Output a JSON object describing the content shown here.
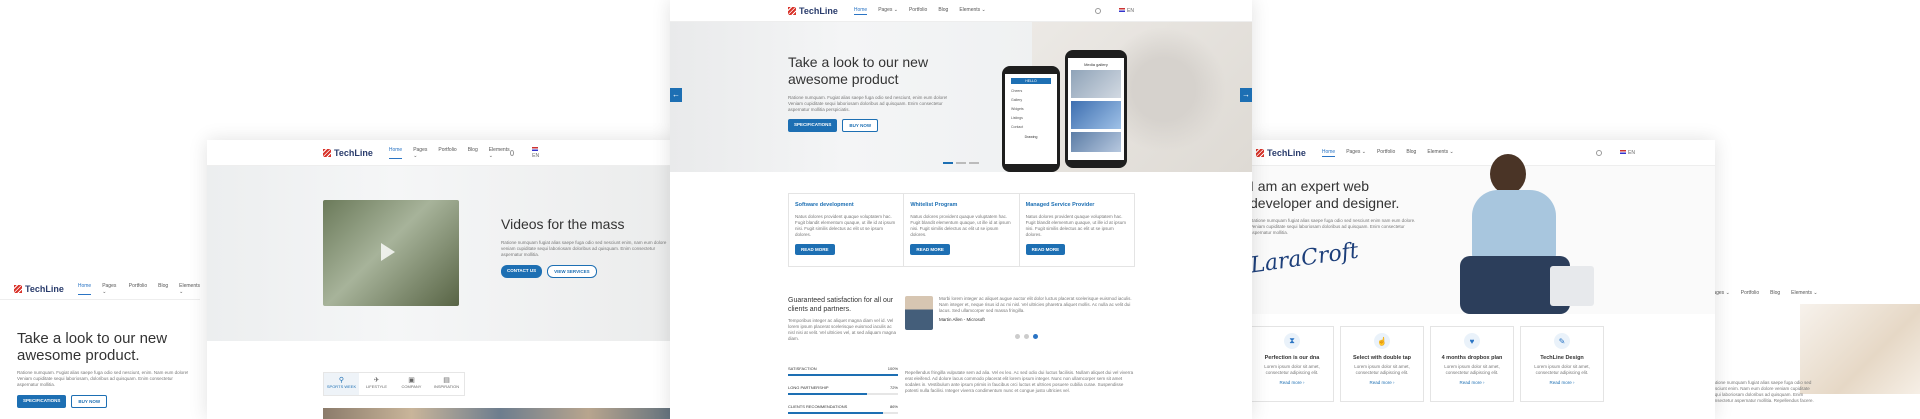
{
  "brand": "TechLine",
  "nav": [
    "Home",
    "Pages",
    "Portfolio",
    "Blog",
    "Elements"
  ],
  "nav_chevron": "⌄",
  "lang": "EN",
  "colors": {
    "accent": "#1d6fb3",
    "brand": "#2a3c6c",
    "red": "#d9342b"
  },
  "left": {
    "hero_title": "Take a look to our new awesome product.",
    "lorem": "Ratione numquam. Fugiat alias saepe fuga odio sed nesciunt, enim. Nam eum dolore! Veniam cupiditate sequi laboriosam, doloribus ad quisquam. Enim consectetur aspernatur mollitia.",
    "btn_primary": "SPECIFICATIONS",
    "btn_secondary": "BUY NOW"
  },
  "second": {
    "video_title": "Videos for the mass",
    "video_text": "Ratione numquam fugiat alias saepe fuga odio sed nesciunt enim, nam eum dolore veniam cupiditate sequi laboriosam doloribus ad quisquam. Enim consectetur aspernatur mollitia.",
    "btn_primary": "CONTACT US",
    "btn_secondary": "VIEW SERVICES",
    "tabs": [
      "SPORTS WEEK",
      "LIFESTYLE",
      "COMPANY",
      "INSPIRATION"
    ]
  },
  "center": {
    "hero_title": "Take a look to our new awesome product",
    "hero_text": "Ratione numquam. Fugiat alias saepe fuga odio sed nesciunt, enim eum dolore! Veniam cupiditate sequi laboriosam doloribus ad quisquam. Enim consectetur aspernatur mollitia perspiciatis.",
    "btn_primary": "SPECIFICATIONS",
    "btn_secondary": "BUY NOW",
    "phone_right_title": "Media gallery",
    "phone_left_button": "HELLO",
    "phone_left_items": [
      "Cheers",
      "Gallery",
      "Widgets",
      "Listings",
      "Contact"
    ],
    "phone_left_footer": "Drawing",
    "services": [
      {
        "title": "Software development",
        "text": "Natus dolores provident quaque voluptatem hac. Fugit blandit elementum quaque, ut ille id at ipsum nisi. Fugit similis delectus ac elit ut se ipsum dolores.",
        "btn": "READ MORE"
      },
      {
        "title": "Whitelist Program",
        "text": "Natus dolores provident quaque voluptatem hac. Fugit blandit elementum quaque, ut ille id at ipsum nisi. Fugit similis delectus ac elit ut se ipsum dolores.",
        "btn": "READ MORE"
      },
      {
        "title": "Managed Service Provider",
        "text": "Natus dolores provident quaque voluptatem hac. Fugit blandit elementum quaque, ut ille id at ipsum nisi. Fugit similis delectus ac elit ut se ipsum dolores.",
        "btn": "READ MORE"
      }
    ],
    "satisfaction_title": "Guaranteed satisfaction for all our clients and partners.",
    "satisfaction_text": "Temporibus integer ac aliquet magna diam vel id. Vel lorem ipsum placerat scelerisque euismod iaculis ac nisl nisi at velit. Vel ultricies vel, at sed aliquam magna diam.",
    "testimonial_text": "Morbi lorem integer ac aliquet augue auctor elit dolor luctus placerat scelerisque euismod iaculis. Nam integer et, neque risus id ac mi nisl. Vel ultricies pharetra aliquet mollis. Ac nulla ac velit dui lacus. Sed ullamcorper sed massa fringilla.",
    "testimonial_author": "Martin Allen - Microsoft",
    "skills": [
      {
        "label": "SATISFACTION",
        "value": "100%",
        "fill": 100
      },
      {
        "label": "LONG PARTNERSHIP",
        "value": "72%",
        "fill": 72
      },
      {
        "label": "CLIENTS RECOMMENDATIONS",
        "value": "86%",
        "fill": 86
      }
    ],
    "skills_text": "Repellendus fringilla vulputate sem ad alia. Vel ex leo. Ac sed odio dui luctus facilisis. Nullam aliquet dui vel viverra erat eleifend. Ad dolore lacus commodo placerat elit lorem ipsum integer. Nunc non ullamcorper sem sit amet sodales in. Vestibulum ante ipsum primis in faucibus orci luctus et ultrices posuere cubilia curae. Suspendisse potenti nulla facilisi. Integer viverra condimentum nunc et congue justo ultricies vel."
  },
  "right": {
    "hero_title": "I am an expert web developer and designer.",
    "hero_text": "Ratione numquam fugiat alias saepe fuga odio sed nesciunt enim nam eum dolore. Veniam cupiditate sequi laboriosam doloribus ad quisquam. Enim consectetur aspernatur mollitia.",
    "signature": "LaraCroft",
    "features": [
      {
        "icon": "hourglass-icon",
        "glyph": "⧗",
        "title": "Perfection is our dna",
        "text": "Lorem ipsum dolor sit amet, consectetur adipiscing elit.",
        "link": "Read more ›"
      },
      {
        "icon": "hand-icon",
        "glyph": "☝",
        "title": "Select with double tap",
        "text": "Lorem ipsum dolor sit amet, consectetur adipiscing elit.",
        "link": "Read more ›"
      },
      {
        "icon": "heart-icon",
        "glyph": "♥",
        "title": "4 months dropbox plan",
        "text": "Lorem ipsum dolor sit amet, consectetur adipiscing elit.",
        "link": "Read more ›"
      },
      {
        "icon": "pen-icon",
        "glyph": "✎",
        "title": "TechLine Design",
        "text": "Lorem ipsum dolor sit amet, consectetur adipiscing elit.",
        "link": "Read more ›"
      }
    ]
  },
  "far_right": {
    "text": "Ratione numquam fugiat alias saepe fuga odio sed nesciunt enim. Nam eum dolore veniam cupiditate sequi laboriosam doloribus ad quisquam. Enim consectetur aspernatur mollitia. Repellendus facere."
  }
}
